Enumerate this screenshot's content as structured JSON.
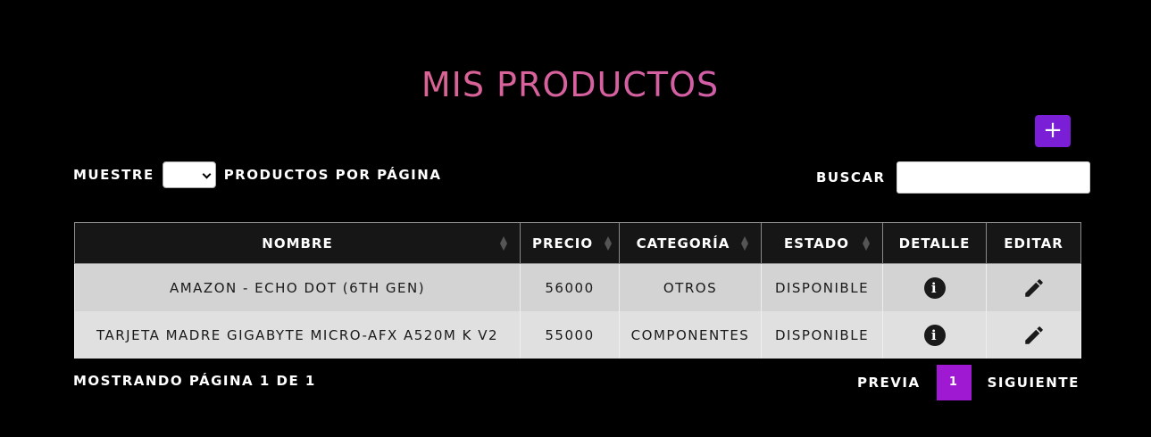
{
  "page": {
    "title": "MIS PRODUCTOS"
  },
  "toolbar": {
    "add_label": "+"
  },
  "length": {
    "prefix": "MUESTRE",
    "selected": "",
    "suffix": "PRODUCTOS POR PÁGINA"
  },
  "search": {
    "label": "BUSCAR",
    "value": ""
  },
  "table": {
    "columns": [
      "NOMBRE",
      "PRECIO",
      "CATEGORÍA",
      "ESTADO",
      "DETALLE",
      "EDITAR"
    ],
    "rows": [
      {
        "nombre": "AMAZON - ECHO DOT (6TH GEN)",
        "precio": "56000",
        "categoria": "OTROS",
        "estado": "DISPONIBLE"
      },
      {
        "nombre": "TARJETA MADRE GIGABYTE MICRO-AFX A520M K V2",
        "precio": "55000",
        "categoria": "COMPONENTES",
        "estado": "DISPONIBLE"
      }
    ]
  },
  "footer": {
    "info": "MOSTRANDO PÁGINA 1 DE 1"
  },
  "pagination": {
    "prev": "PREVIA",
    "current": "1",
    "next": "SIGUIENTE"
  },
  "icons": {
    "detail": "info-icon",
    "edit": "pencil-icon",
    "sort": "sort-icon",
    "select_arrow": "chevron-down-icon"
  },
  "colors": {
    "accent": "#7a1fd6",
    "pager_active": "#a019d2",
    "title_from": "#e36a7e",
    "title_to": "#b250d8",
    "background": "#000000"
  }
}
